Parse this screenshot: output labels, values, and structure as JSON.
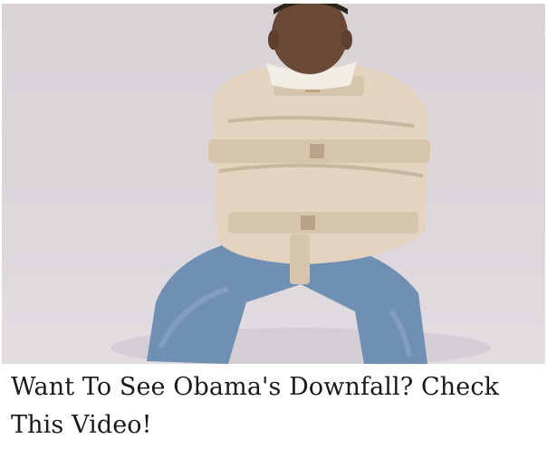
{
  "ad": {
    "image": {
      "icon": "photo-placeholder"
    },
    "headline": "Want To See Obama's Downfall? Check This Video!"
  },
  "colors": {
    "background": "#ffffff",
    "photo_backdrop": "#ddd7dc",
    "headline_text": "#1a1a1a"
  }
}
